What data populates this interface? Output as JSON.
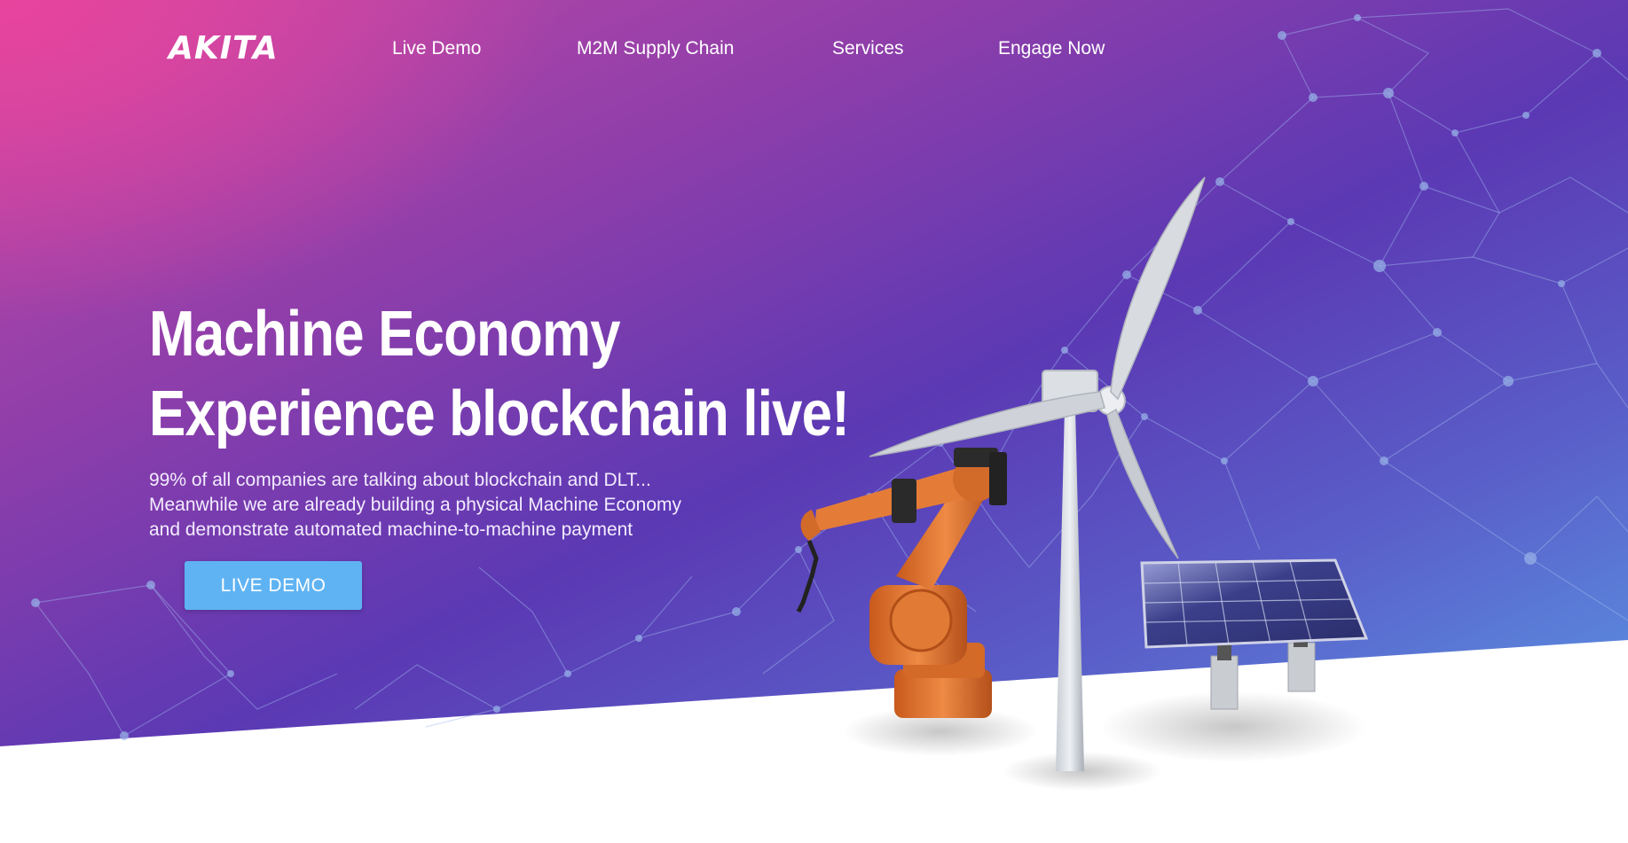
{
  "header": {
    "logo_text": "AKITA",
    "nav": [
      {
        "label": "Live Demo"
      },
      {
        "label": "M2M Supply Chain"
      },
      {
        "label": "Services"
      },
      {
        "label": "Engage Now"
      }
    ]
  },
  "hero": {
    "headline_line1": "Machine Economy",
    "headline_line2": "Experience blockchain live!",
    "description": [
      "99% of all companies are talking about blockchain and DLT...",
      "Meanwhile we are already building a physical Machine Economy",
      "and demonstrate automated machine-to-machine payment"
    ],
    "cta_label": "LIVE DEMO"
  },
  "colors": {
    "gradient_pink": "#e8449d",
    "gradient_purple": "#5b39b4",
    "gradient_blue": "#5aa3ea",
    "button_blue": "#5fb3f3"
  },
  "illustration": {
    "icons": [
      "robot-arm-icon",
      "wind-turbine-icon",
      "solar-panel-icon",
      "network-mesh-icon"
    ]
  }
}
